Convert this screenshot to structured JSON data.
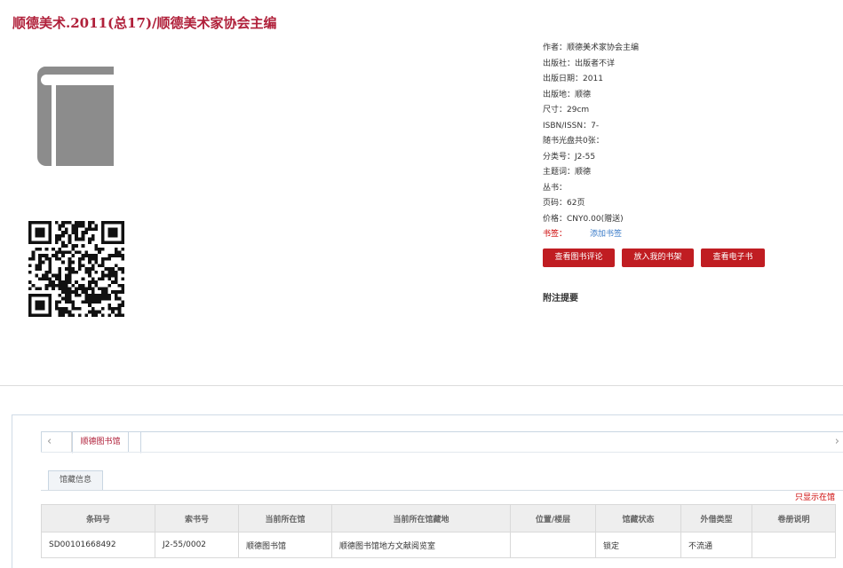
{
  "book": {
    "title": "顺德美术.2011(总17)/顺德美术家协会主编"
  },
  "meta": [
    {
      "key": "作者：",
      "value": "顺德美术家协会主编"
    },
    {
      "key": "出版社：",
      "value": "出版者不详"
    },
    {
      "key": "出版日期：",
      "value": "2011"
    },
    {
      "key": "出版地：",
      "value": "顺德"
    },
    {
      "key": "尺寸：",
      "value": "29cm"
    },
    {
      "key": "ISBN/ISSN：",
      "value": "7-"
    },
    {
      "key": "随书光盘共0张：",
      "value": ""
    },
    {
      "key": "分类号：",
      "value": "J2-55"
    },
    {
      "key": "主题词：",
      "value": "顺德"
    },
    {
      "key": "丛书：",
      "value": ""
    },
    {
      "key": "页码：",
      "value": "62页"
    },
    {
      "key": "价格：",
      "value": "CNY0.00(赠送)"
    }
  ],
  "tags": {
    "label": "书签：",
    "link": "添加书签"
  },
  "actions": {
    "review": "查看图书评论",
    "shelf": "放入我的书架",
    "ebook": "查看电子书"
  },
  "note_title": "附注提要",
  "tabs": {
    "arrow_left": "‹",
    "arrow_right": "›",
    "library": "顺德图书馆"
  },
  "subtab": "馆藏信息",
  "show_only_link": "只显示在馆",
  "holdings": {
    "headers": [
      "条码号",
      "索书号",
      "当前所在馆",
      "当前所在馆藏地",
      "位置/楼层",
      "馆藏状态",
      "外借类型",
      "卷册说明"
    ],
    "rows": [
      [
        "SD00101668492",
        "J2-55/0002",
        "顺德图书馆",
        "顺德图书馆地方文献阅览室",
        "",
        "锁定",
        "不流通",
        ""
      ]
    ]
  },
  "icons": {
    "book": "book-icon",
    "qr": "qr-code"
  },
  "colors": {
    "accent": "#b0203a",
    "button": "#c01d22",
    "link": "#3a7bc8"
  }
}
